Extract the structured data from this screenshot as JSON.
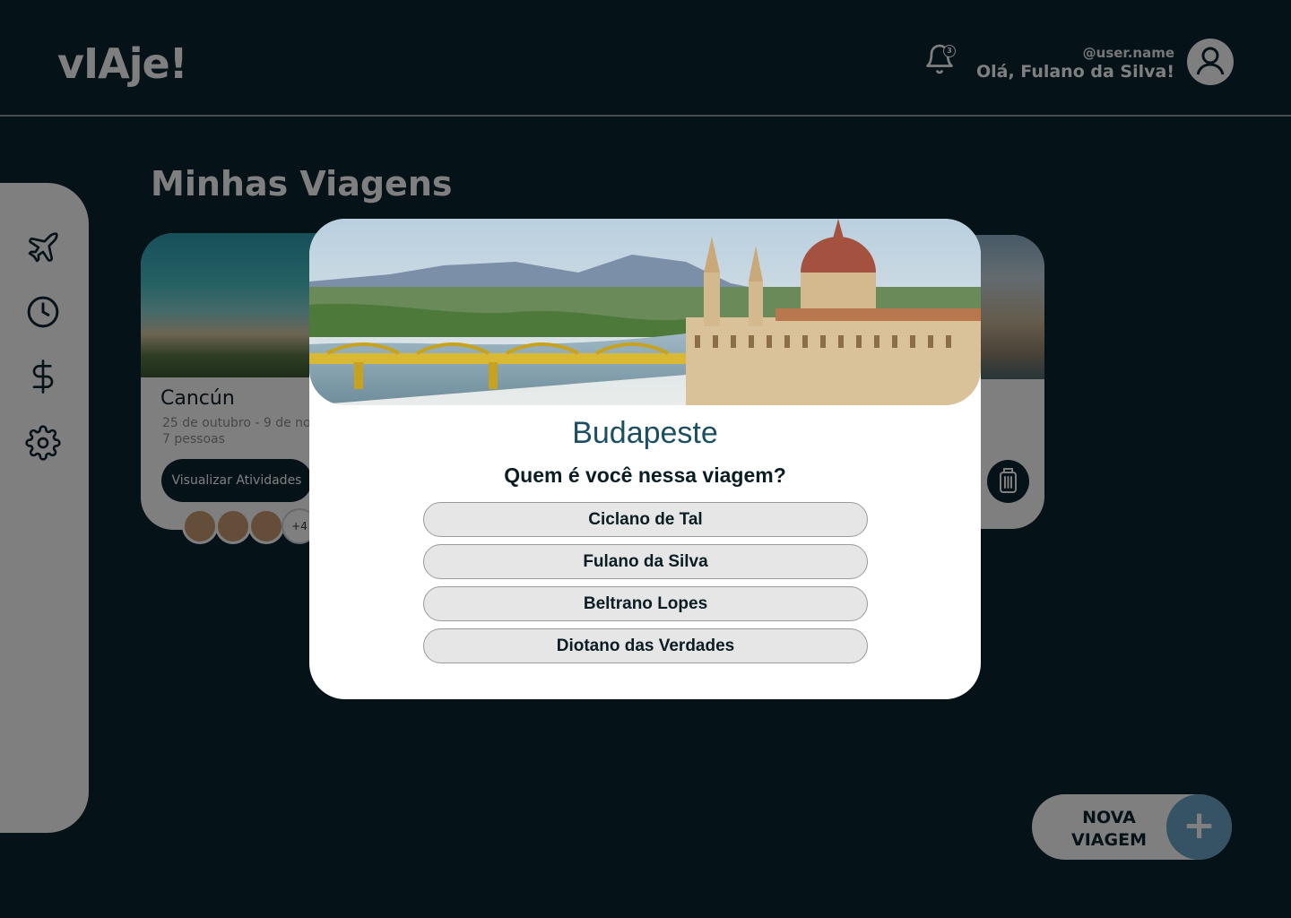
{
  "header": {
    "logo": "vIAje!",
    "notification_count": "3",
    "user_handle": "@user.name",
    "greeting": "Olá, Fulano da Silva!"
  },
  "sidebar": {
    "items": [
      {
        "icon": "airplane-icon"
      },
      {
        "icon": "clock-icon"
      },
      {
        "icon": "dollar-icon"
      },
      {
        "icon": "gear-icon"
      }
    ]
  },
  "main": {
    "title": "Minhas Viagens",
    "trips": [
      {
        "title": "Cancún",
        "dates": "25 de outubro - 9 de no",
        "people": "7 pessoas",
        "button_label": "Visualizar Atividades",
        "participants_more": "+4"
      }
    ]
  },
  "fab": {
    "label_line1": "NOVA",
    "label_line2": "VIAGEM",
    "plus": "+"
  },
  "modal": {
    "city": "Budapeste",
    "question": "Quem é você nessa viagem?",
    "options": [
      "Ciclano de Tal",
      "Fulano da Silva",
      "Beltrano Lopes",
      "Diotano das Verdades"
    ]
  },
  "colors": {
    "background": "#0a2733",
    "accent": "#1c4f63",
    "fab_plus": "#6aa6c8",
    "option_bg": "#e6e6e6"
  }
}
